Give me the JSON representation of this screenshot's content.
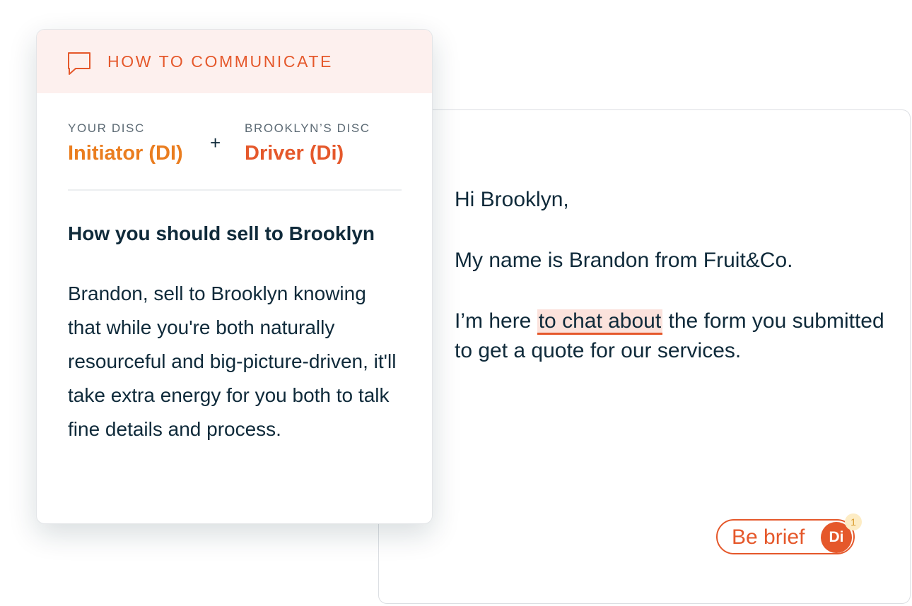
{
  "colors": {
    "accent": "#e5582b",
    "accent_orange": "#ea7d1f",
    "text_dark": "#0f2a3a",
    "header_bg": "#fdf0ee",
    "highlight_bg": "#fbe2dc"
  },
  "comm_card": {
    "header_icon": "chat-bubble-icon",
    "header_title": "HOW TO COMMUNICATE",
    "your_disc_label": "YOUR DISC",
    "your_disc_value": "Initiator (DI)",
    "plus": "+",
    "their_disc_label": "BROOKLYN’S DISC",
    "their_disc_value": "Driver (Di)",
    "sell_title": "How you should sell to Brooklyn",
    "sell_text": "Brandon, sell to Brooklyn knowing that while you're both naturally resourceful and big-picture-driven, it'll take extra energy for you both to talk fine details and process."
  },
  "email": {
    "greeting": "Hi Brooklyn,",
    "intro": "My name is Brandon from Fruit&Co.",
    "line3_prefix": "I’m here ",
    "line3_highlight": "to chat about",
    "line3_suffix": " the form you submitted to get a quote for our services."
  },
  "suggestion_chip": {
    "label": "Be brief",
    "badge": "Di",
    "count": "1"
  }
}
